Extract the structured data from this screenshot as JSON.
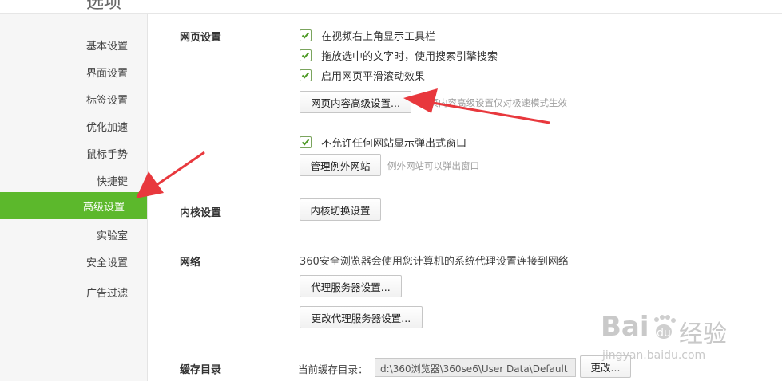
{
  "page": {
    "title": "选项"
  },
  "sidebar": {
    "items": [
      {
        "label": "基本设置"
      },
      {
        "label": "界面设置"
      },
      {
        "label": "标签设置"
      },
      {
        "label": "优化加速"
      },
      {
        "label": "鼠标手势"
      },
      {
        "label": "快捷键"
      },
      {
        "label": "高级设置",
        "active": true
      },
      {
        "label": "实验室"
      },
      {
        "label": "安全设置"
      },
      {
        "label": "广告过滤"
      }
    ]
  },
  "webpage": {
    "label": "网页设置",
    "options": [
      {
        "label": "在视频右上角显示工具栏",
        "checked": true
      },
      {
        "label": "拖放选中的文字时，使用搜索引擎搜索",
        "checked": true
      },
      {
        "label": "启用网页平滑滚动效果",
        "checked": true
      }
    ],
    "advanced_button": "网页内容高级设置...",
    "advanced_hint": "网页内容高级设置仅对极速模式生效",
    "popup_option": {
      "label": "不允许任何网站显示弹出式窗口",
      "checked": true
    },
    "exceptions_button": "管理例外网站",
    "exceptions_hint": "例外网站可以弹出窗口"
  },
  "kernel": {
    "label": "内核设置",
    "button": "内核切换设置"
  },
  "network": {
    "label": "网络",
    "description": "360安全浏览器会使用您计算机的系统代理设置连接到网络",
    "proxy_button": "代理服务器设置...",
    "change_proxy_button": "更改代理服务器设置..."
  },
  "cache": {
    "label": "缓存目录",
    "current_label": "当前缓存目录：",
    "path": "d:\\360浏览器\\360se6\\User Data\\Default",
    "change_button": "更改..."
  },
  "watermark": {
    "line1": "Bai",
    "line1b": "经验",
    "line2": "jingyan.baidu.com"
  },
  "colors": {
    "accent": "#5cb82c",
    "arrow": "#e8383d",
    "checkbox": "#4e9a26"
  }
}
